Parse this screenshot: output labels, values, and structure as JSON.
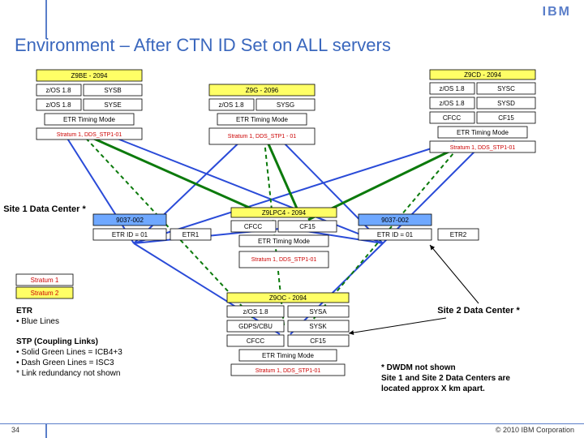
{
  "logo_text": "IBM",
  "title": "Environment – After CTN ID Set on ALL servers",
  "page_num": "34",
  "copyright": "© 2010 IBM Corporation",
  "z9be": {
    "hdr": "Z9BE - 2094",
    "r1a": "z/OS 1.8",
    "r1b": "SYSB",
    "r2a": "z/OS 1.8",
    "r2b": "SYSE",
    "tim": "ETR Timing Mode",
    "str": "Stratum 1, DDS_STP1-01"
  },
  "z9cd": {
    "hdr": "Z9CD - 2094",
    "r1a": "z/OS 1.8",
    "r1b": "SYSC",
    "r2a": "z/OS 1.8",
    "r2b": "SYSD",
    "r3a": "CFCC",
    "r3b": "CF15",
    "tim": "ETR Timing Mode",
    "str": "Stratum 1, DDS_STP1-01"
  },
  "z9g": {
    "hdr": "Z9G - 2096",
    "r1a": "z/OS 1.8",
    "r1b": "SYSG",
    "tim": "ETR Timing Mode",
    "str": "Stratum 1, DDS_STP1 - 01"
  },
  "z9lp": {
    "hdr": "Z9LPC4 - 2094",
    "r1a": "CFCC",
    "r1b": "CF15",
    "tim": "ETR Timing Mode",
    "str": "Stratum 1, DDS_STP1-01"
  },
  "z9oc": {
    "hdr": "Z9OC - 2094",
    "r1a": "z/OS 1.8",
    "r1b": "SYSA",
    "r2a": "GDPS/CBU",
    "r2b": "SYSK",
    "r3a": "CFCC",
    "r3b": "CF15",
    "tim": "ETR Timing Mode",
    "str": "Stratum 1, DDS_STP1-01"
  },
  "box9037_L": {
    "id": "9037-002",
    "etr": "ETR ID = 01",
    "port": "ETR1"
  },
  "box9037_R": {
    "id": "9037-002",
    "etr": "ETR ID = 01",
    "port": "ETR2"
  },
  "site1": "Site 1 Data Center *",
  "site2": "Site 2 Data Center *",
  "legend": {
    "s1": "Stratum 1",
    "s2": "Stratum 2"
  },
  "txt_etr_hdr": "ETR",
  "txt_etr_sub": "• Blue Lines",
  "txt_stp_hdr": "STP (Coupling Links)",
  "txt_stp_l1": "• Solid Green Lines = ICB4+3",
  "txt_stp_l2": "• Dash Green Lines = ISC3",
  "txt_stp_l3": "* Link redundancy not shown",
  "note_l1": "* DWDM not shown",
  "note_l2": "  Site 1 and Site 2 Data Centers are",
  "note_l3": "  located approx X km apart."
}
